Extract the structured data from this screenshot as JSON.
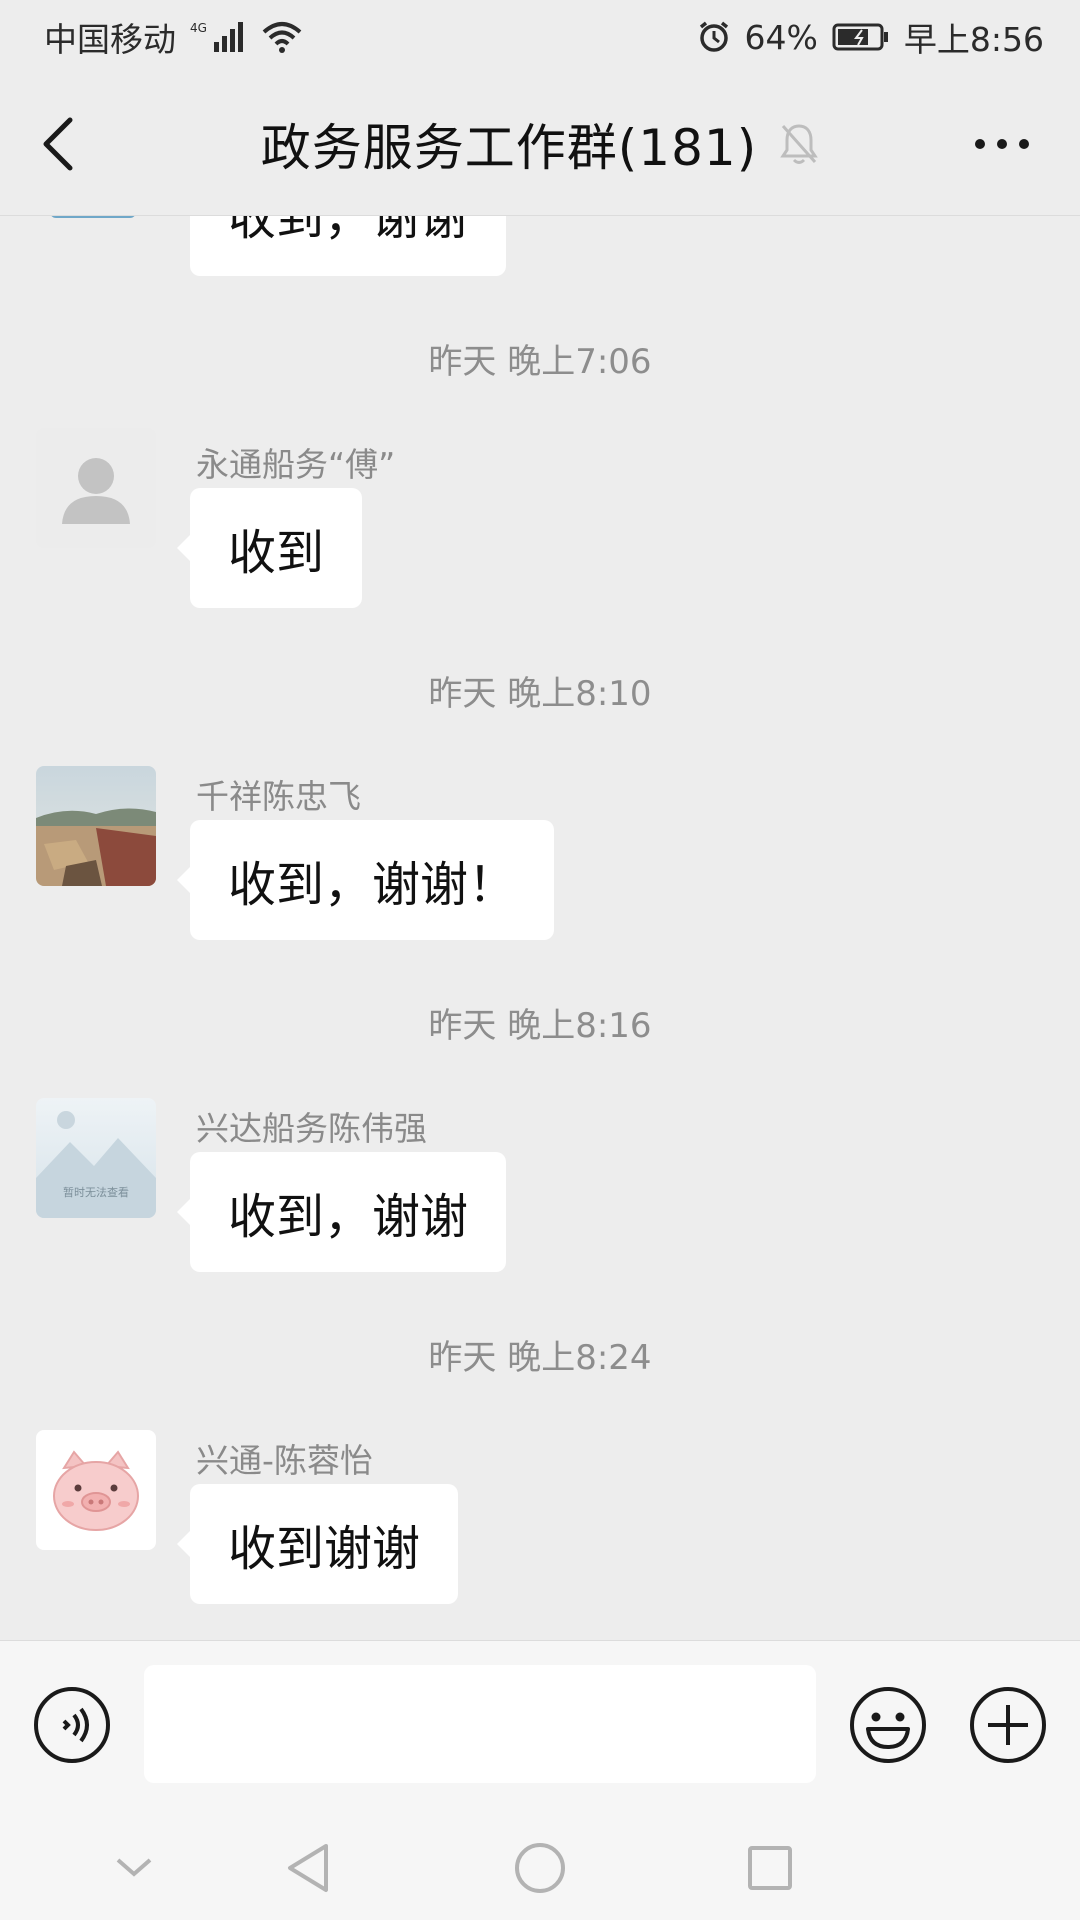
{
  "status_bar": {
    "carrier": "中国移动",
    "network": "4G",
    "battery_percent": "64%",
    "time": "早上8:56"
  },
  "header": {
    "title": "政务服务工作群(181)",
    "muted_icon": "bell-off-icon",
    "back_icon": "chevron-left-icon",
    "more_icon": "more-horizontal-icon"
  },
  "chat": {
    "partial_message": "收到，谢谢",
    "messages": [
      {
        "timestamp": "昨天 晚上7:06",
        "sender": "永通船务“傅”",
        "text": "收到",
        "avatar": "default-person-avatar"
      },
      {
        "timestamp": "昨天 晚上8:10",
        "sender": "千祥陈忠飞",
        "text": "收到，谢谢！",
        "avatar": "photo-avatar"
      },
      {
        "timestamp": "昨天 晚上8:16",
        "sender": "兴达船务陈伟强",
        "text": "收到，谢谢",
        "avatar": "image-unavailable-avatar",
        "avatar_caption": "暂时无法查看"
      },
      {
        "timestamp": "昨天 晚上8:24",
        "sender": "兴通-陈蓉怡",
        "text": "收到谢谢",
        "avatar": "pig-avatar"
      }
    ]
  },
  "input_bar": {
    "voice_icon": "voice-icon",
    "emoji_icon": "emoji-icon",
    "plus_icon": "plus-circle-icon",
    "input_value": ""
  },
  "nav_bar": {
    "icons": [
      "collapse-icon",
      "back-triangle-icon",
      "home-circle-icon",
      "recents-square-icon"
    ]
  },
  "colors": {
    "background": "#ededed",
    "bubble": "#ffffff",
    "timestamp_text": "#8d8d8d",
    "sender_text": "#8a8a8a"
  }
}
